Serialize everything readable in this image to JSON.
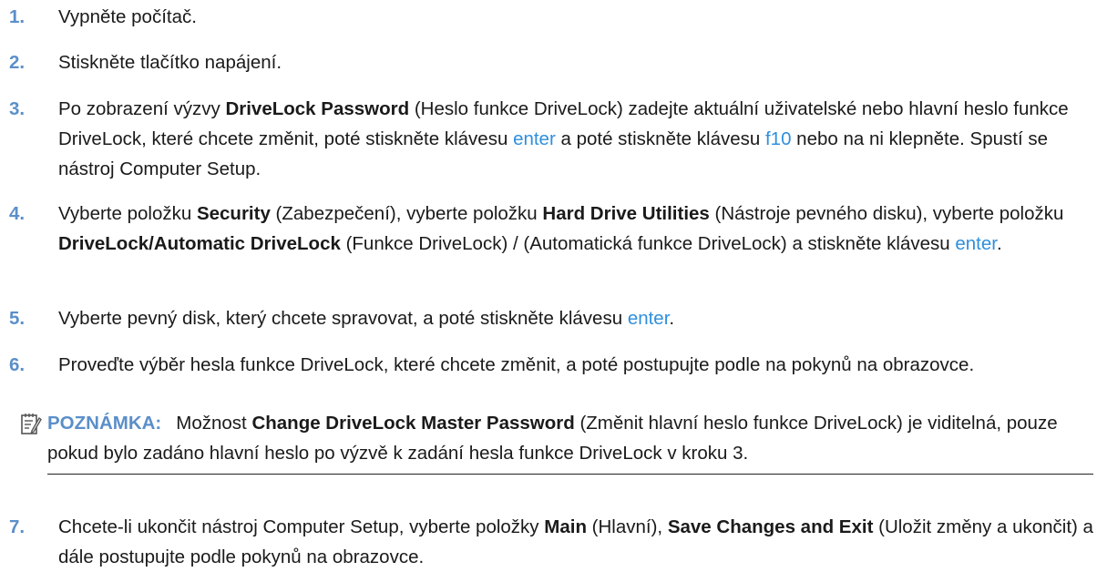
{
  "colors": {
    "step_number": "#5b8fc9",
    "key": "#2f8fdd",
    "text": "#1a1a1a"
  },
  "steps": [
    {
      "num": "1.",
      "text": "Vypněte počítač."
    },
    {
      "num": "2.",
      "text": "Stiskněte tlačítko napájení."
    },
    {
      "num": "3.",
      "t1": "Po zobrazení výzvy ",
      "b1": "DriveLock Password",
      "t2": " (Heslo funkce DriveLock) zadejte aktuální uživatelské nebo hlavní heslo funkce DriveLock, které chcete změnit, poté stiskněte klávesu ",
      "k1": "enter",
      "t3": " a poté stiskněte klávesu ",
      "k2": "f10",
      "t4": " nebo na ni klepněte. Spustí se nástroj Computer Setup."
    },
    {
      "num": "4.",
      "t1": "Vyberte položku ",
      "b1": "Security",
      "t2": " (Zabezpečení), vyberte položku ",
      "b2": "Hard Drive Utilities",
      "t3": " (Nástroje pevného disku), vyberte položku ",
      "b3": "DriveLock/Automatic DriveLock",
      "t4": " (Funkce DriveLock) / (Automatická funkce DriveLock) a stiskněte klávesu ",
      "k1": "enter",
      "t5": "."
    },
    {
      "num": "5.",
      "t1": "Vyberte pevný disk, který chcete spravovat, a poté stiskněte klávesu ",
      "k1": "enter",
      "t2": "."
    },
    {
      "num": "6.",
      "text": "Proveďte výběr hesla funkce DriveLock, které chcete změnit, a poté postupujte podle na pokynů na obrazovce."
    },
    {
      "num": "7.",
      "t1": "Chcete-li ukončit nástroj Computer Setup, vyberte položky ",
      "b1": "Main",
      "t2": " (Hlavní), ",
      "b2": "Save Changes and Exit",
      "t3": " (Uložit změny a ukončit) a dále postupujte podle pokynů na obrazovce."
    }
  ],
  "note": {
    "icon": "note-pencil-icon",
    "label": "POZNÁMKA:",
    "t1": "Možnost ",
    "b1": "Change DriveLock Master Password",
    "t2": " (Změnit hlavní heslo funkce DriveLock) je viditelná, pouze pokud bylo zadáno hlavní heslo po výzvě k zadání hesla funkce DriveLock v kroku 3."
  }
}
